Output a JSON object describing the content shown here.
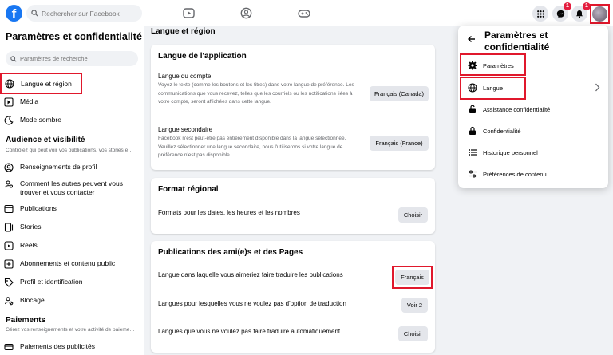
{
  "topbar": {
    "logo": "f",
    "search_placeholder": "Rechercher sur Facebook",
    "messenger_badge": "1",
    "notifications_badge": "1"
  },
  "sidebar": {
    "title": "Paramètres et confidentialité",
    "search_placeholder": "Paramètres de recherche",
    "items_top": [
      {
        "label": "Langue et région"
      },
      {
        "label": "Média"
      },
      {
        "label": "Mode sombre"
      }
    ],
    "audience": {
      "title": "Audience et visibilité",
      "subtitle": "Contrôlez qui peut voir vos publications, vos stories e…",
      "items": [
        {
          "label": "Renseignements de profil"
        },
        {
          "label": "Comment les autres peuvent vous trouver et vous contacter"
        },
        {
          "label": "Publications"
        },
        {
          "label": "Stories"
        },
        {
          "label": "Reels"
        },
        {
          "label": "Abonnements et contenu public"
        },
        {
          "label": "Profil et identification"
        },
        {
          "label": "Blocage"
        }
      ]
    },
    "payments": {
      "title": "Paiements",
      "subtitle": "Gérez vos renseignements et votre activité de paieme…",
      "items": [
        {
          "label": "Paiements des publicités"
        }
      ]
    }
  },
  "main": {
    "title": "Langue et région",
    "app_language": {
      "title": "Langue de l'application",
      "account_language": {
        "label": "Langue du compte",
        "desc": "Voyez le texte (comme les boutons et les titres) dans votre langue de préférence. Les communications que vous recevez, telles que les courriels ou les notifications liées à votre compte, seront affichées dans cette langue.",
        "button": "Français (Canada)"
      },
      "secondary_language": {
        "label": "Langue secondaire",
        "desc": "Facebook n'est peut-être pas entièrement disponible dans la langue sélectionnée. Veuillez sélectionner une langue secondaire, nous l'utiliserons si votre langue de préférence n'est pas disponible.",
        "button": "Français (France)"
      }
    },
    "regional_format": {
      "title": "Format régional",
      "label": "Formats pour les dates, les heures et les nombres",
      "button": "Choisir"
    },
    "posts": {
      "title": "Publications des ami(e)s et des Pages",
      "rows": [
        {
          "label": "Langue dans laquelle vous aimeriez faire traduire les publications",
          "button": "Français"
        },
        {
          "label": "Langues pour lesquelles vous ne voulez pas d'option de traduction",
          "button": "Voir 2"
        },
        {
          "label": "Langues que vous ne voulez pas faire traduire automatiquement",
          "button": "Choisir"
        }
      ]
    }
  },
  "dropdown": {
    "title": "Paramètres et confidentialité",
    "items": [
      {
        "label": "Paramètres",
        "icon": "gear-icon"
      },
      {
        "label": "Langue",
        "icon": "globe-icon"
      },
      {
        "label": "Assistance confidentialité",
        "icon": "lock-open-icon"
      },
      {
        "label": "Confidentialité",
        "icon": "lock-icon"
      },
      {
        "label": "Historique personnel",
        "icon": "list-icon"
      },
      {
        "label": "Préférences de contenu",
        "icon": "sliders-icon"
      }
    ]
  },
  "colors": {
    "brand": "#1877f2",
    "highlight": "#e0182c",
    "badge": "#e41e3f"
  }
}
